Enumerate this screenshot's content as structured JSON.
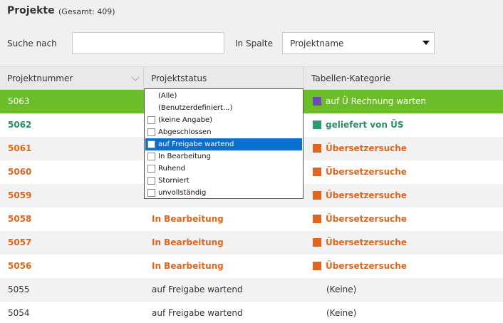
{
  "header": {
    "title": "Projekte",
    "total": "(Gesamt: 409)"
  },
  "filter": {
    "search_label": "Suche nach",
    "search_value": "",
    "column_label": "In Spalte",
    "column_value": "Projektname"
  },
  "table": {
    "columns": [
      "Projektnummer",
      "Projektstatus",
      "Tabellen-Kategorie"
    ],
    "rows": [
      {
        "number": "5063",
        "status": "",
        "category": "auf Ü Rechnung warten",
        "color": "#6a4bb8",
        "selected": true
      },
      {
        "number": "5062",
        "status": "",
        "category": "geliefert von ÜS",
        "color": "#2a9c7a"
      },
      {
        "number": "5061",
        "status": "",
        "category": "Übersetzersuche",
        "color": "#e0651e"
      },
      {
        "number": "5060",
        "status": "",
        "category": "Übersetzersuche",
        "color": "#e0651e"
      },
      {
        "number": "5059",
        "status": "",
        "category": "Übersetzersuche",
        "color": "#e0651e"
      },
      {
        "number": "5058",
        "status": "In Bearbeitung",
        "category": "Übersetzersuche",
        "color": "#e0651e"
      },
      {
        "number": "5057",
        "status": "In Bearbeitung",
        "category": "Übersetzersuche",
        "color": "#e0651e"
      },
      {
        "number": "5056",
        "status": "In Bearbeitung",
        "category": "Übersetzersuche",
        "color": "#e0651e"
      },
      {
        "number": "5055",
        "status": "auf Freigabe wartend",
        "category": "(Keine)"
      },
      {
        "number": "5054",
        "status": "auf Freigabe wartend",
        "category": "(Keine)"
      }
    ]
  },
  "status_filter_dropdown": {
    "options": [
      {
        "label": "(Alle)",
        "checkbox": false
      },
      {
        "label": "(Benutzerdefiniert...)",
        "checkbox": false
      },
      {
        "label": "(keine Angabe)",
        "checkbox": true
      },
      {
        "label": "Abgeschlossen",
        "checkbox": true
      },
      {
        "label": "auf Freigabe wartend",
        "checkbox": true,
        "highlighted": true
      },
      {
        "label": "In Bearbeitung",
        "checkbox": true
      },
      {
        "label": "Ruhend",
        "checkbox": true
      },
      {
        "label": "Storniert",
        "checkbox": true
      },
      {
        "label": "unvollständig",
        "checkbox": true
      }
    ]
  },
  "colors": {
    "selected_row": "#6cbd2a",
    "orange": "#e0651e",
    "teal": "#2a8c6d",
    "highlight": "#0a6fd0"
  }
}
